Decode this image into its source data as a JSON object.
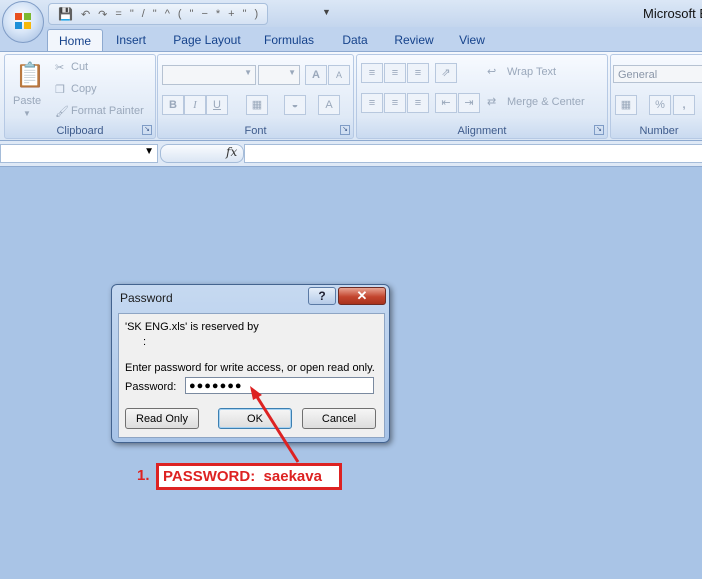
{
  "app": {
    "title": "Microsoft E"
  },
  "quick_access": {
    "items": [
      "=",
      "\"",
      "/",
      "\"",
      "^",
      "(",
      "\"",
      "−",
      "*",
      "+",
      "\"",
      ")"
    ]
  },
  "ribbon": {
    "tabs": [
      "Home",
      "Insert",
      "Page Layout",
      "Formulas",
      "Data",
      "Review",
      "View"
    ],
    "active_tab": "Home",
    "clipboard": {
      "paste": "Paste",
      "cut": "Cut",
      "copy": "Copy",
      "format_painter": "Format Painter",
      "label": "Clipboard"
    },
    "font": {
      "label": "Font",
      "bold": "B",
      "italic": "I",
      "underline": "U",
      "grow": "A",
      "shrink": "A",
      "color": "A"
    },
    "alignment": {
      "wrap_text": "Wrap Text",
      "merge_center": "Merge & Center",
      "label": "Alignment"
    },
    "number": {
      "format": "General",
      "percent": "%",
      "comma": ",",
      "label": "Number"
    }
  },
  "formula_bar": {
    "fx": "fx"
  },
  "dialog": {
    "title": "Password",
    "help": "?",
    "close": "✕",
    "message_line1": "'SK ENG.xls' is reserved by",
    "message_line2": ":",
    "message_line3": "Enter password for write access, or open read only.",
    "password_label": "Password:",
    "password_value": "●●●●●●●",
    "read_only": "Read Only",
    "ok": "OK",
    "cancel": "Cancel"
  },
  "annotation": {
    "number": "1.",
    "text": "PASSWORD:  saekava"
  },
  "colors": {
    "annotation": "#d22222",
    "workspace": "#a9c4e6"
  }
}
